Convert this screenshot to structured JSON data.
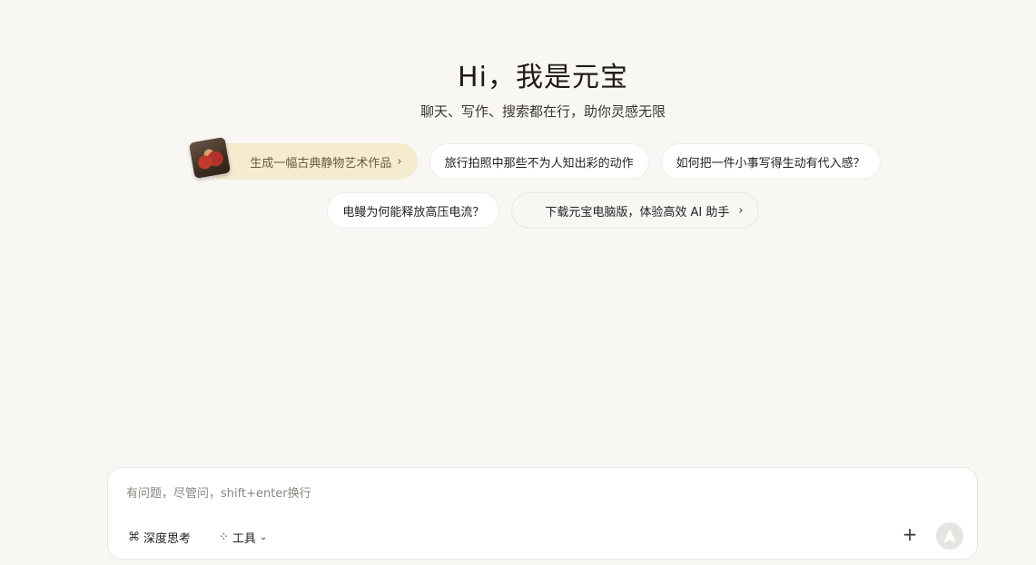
{
  "hero": {
    "title": "Hi，我是元宝",
    "subtitle": "聊天、写作、搜索都在行，助你灵感无限"
  },
  "suggestions": {
    "row1": [
      {
        "label": "生成一幅古典静物艺术作品",
        "chevron": "›",
        "featured": true
      },
      {
        "label": "旅行拍照中那些不为人知出彩的动作"
      },
      {
        "label": "如何把一件小事写得生动有代入感？"
      }
    ],
    "row2": [
      {
        "label": "电鳗为何能释放高压电流？"
      },
      {
        "label": "下载元宝电脑版，体验高效 AI 助手",
        "chevron": "›"
      }
    ]
  },
  "composer": {
    "placeholder": "有问题，尽管问，shift+enter换行",
    "value": "",
    "deep_think_label": "深度思考",
    "deep_think_icon": "⌘",
    "tools_label": "工具",
    "tools_icon": "⁘",
    "tools_caret": "⌄",
    "plus_icon": "+",
    "send_icon": "send-arrow-icon"
  },
  "colors": {
    "background": "#f8f7f4",
    "featured_chip": "#f5ebcf",
    "send_button": "#e6e4e1"
  }
}
